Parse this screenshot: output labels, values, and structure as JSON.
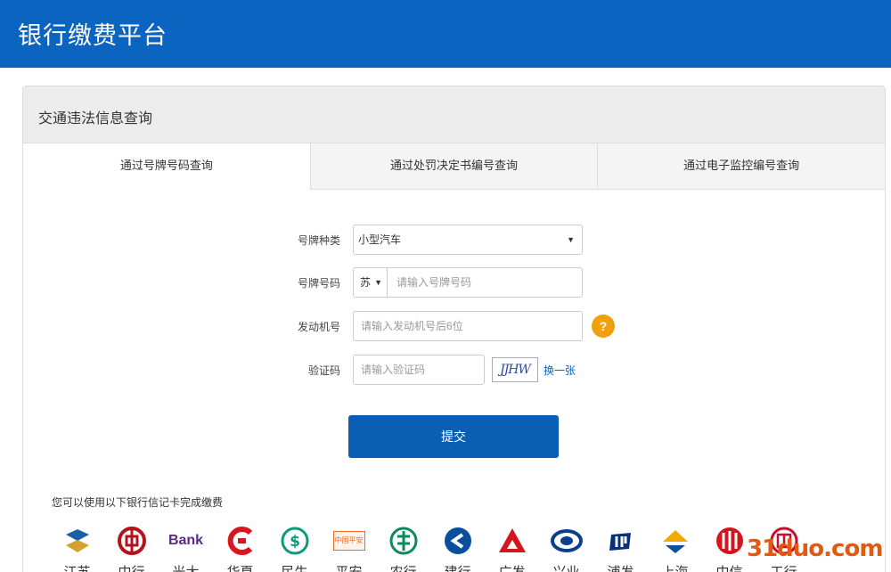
{
  "app": {
    "title": "银行缴费平台"
  },
  "panel": {
    "title": "交通违法信息查询"
  },
  "tabs": [
    "通过号牌号码查询",
    "通过处罚决定书编号查询",
    "通过电子监控编号查询"
  ],
  "form": {
    "plate_type_label": "号牌种类",
    "plate_type_value": "小型汽车",
    "plate_no_label": "号牌号码",
    "plate_prefix": "苏",
    "plate_no_placeholder": "请输入号牌号码",
    "engine_label": "发动机号",
    "engine_placeholder": "请输入发动机号后6位",
    "help_symbol": "?",
    "captcha_label": "验证码",
    "captcha_placeholder": "请输入验证码",
    "captcha_image_text": "JJHW",
    "refresh_label": "换一张",
    "submit_label": "提交"
  },
  "banks": {
    "note": "您可以使用以下银行信记卡完成缴费",
    "list": [
      "江苏",
      "中行",
      "光大",
      "华夏",
      "民生",
      "平安",
      "农行",
      "建行",
      "广发",
      "兴业",
      "浦发",
      "上海",
      "中信",
      "工行"
    ],
    "logo_texts": {
      "guangda": "Bank",
      "pingan": "中国平安"
    }
  },
  "watermark": "31duo.com",
  "colors": {
    "header": "#0a64c0",
    "submit": "#0a5fb5",
    "help": "#f0a00c"
  }
}
